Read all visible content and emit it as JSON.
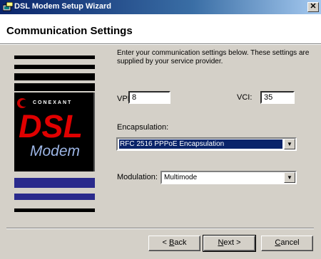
{
  "window": {
    "title": "DSL Modem Setup Wizard",
    "close_glyph": "✕"
  },
  "header": {
    "title": "Communication Settings"
  },
  "logo": {
    "brand": "CONEXANT",
    "product_big": "DSL",
    "product_small": "Modem"
  },
  "intro": "Enter your communication settings below.  These settings are supplied by your service provider.",
  "vpi": {
    "label": "VPI:",
    "value": "8"
  },
  "vci": {
    "label": "VCI:",
    "value": "35"
  },
  "encapsulation": {
    "label": "Encapsulation:",
    "value": "RFC 2516 PPPoE Encapsulation"
  },
  "modulation": {
    "label": "Modulation:",
    "value": "Multimode"
  },
  "buttons": {
    "back_label": "< Back",
    "back_accel": "B",
    "next_label": "Next >",
    "next_accel": "N",
    "cancel_label": "Cancel",
    "cancel_accel": "C"
  },
  "colors": {
    "title_bar": "#0a246a",
    "dsl_red": "#e00000",
    "stripe_blue": "#2a2a8c"
  }
}
